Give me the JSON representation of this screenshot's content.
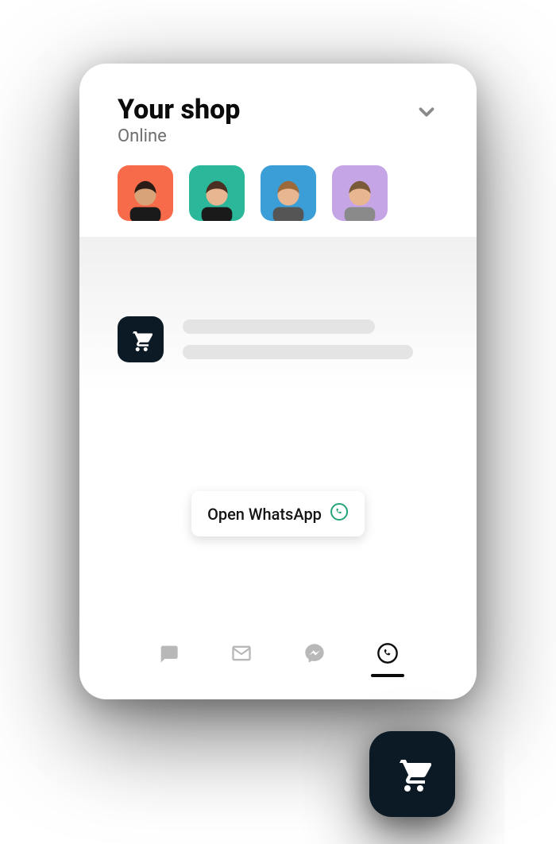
{
  "header": {
    "title": "Your shop",
    "status": "Online"
  },
  "avatars": [
    {
      "bg": "#f76b4a",
      "skin": "#d9a37a",
      "hair": "#2a1c14",
      "shirt": "#1a1a1a"
    },
    {
      "bg": "#2ab79a",
      "skin": "#e8b690",
      "hair": "#4a2f22",
      "shirt": "#1a1a1a"
    },
    {
      "bg": "#3b9ed6",
      "skin": "#e8b690",
      "hair": "#9c6a3a",
      "shirt": "#555555"
    },
    {
      "bg": "#c6a5e6",
      "skin": "#e8b690",
      "hair": "#7a5a38",
      "shirt": "#8a8a8a"
    }
  ],
  "action": {
    "whatsapp_label": "Open WhatsApp"
  },
  "tabs": [
    {
      "name": "chat",
      "active": false
    },
    {
      "name": "email",
      "active": false
    },
    {
      "name": "messenger",
      "active": false
    },
    {
      "name": "whatsapp",
      "active": true
    }
  ],
  "colors": {
    "whatsapp_green": "#25a378",
    "dark": "#0b1a24"
  }
}
